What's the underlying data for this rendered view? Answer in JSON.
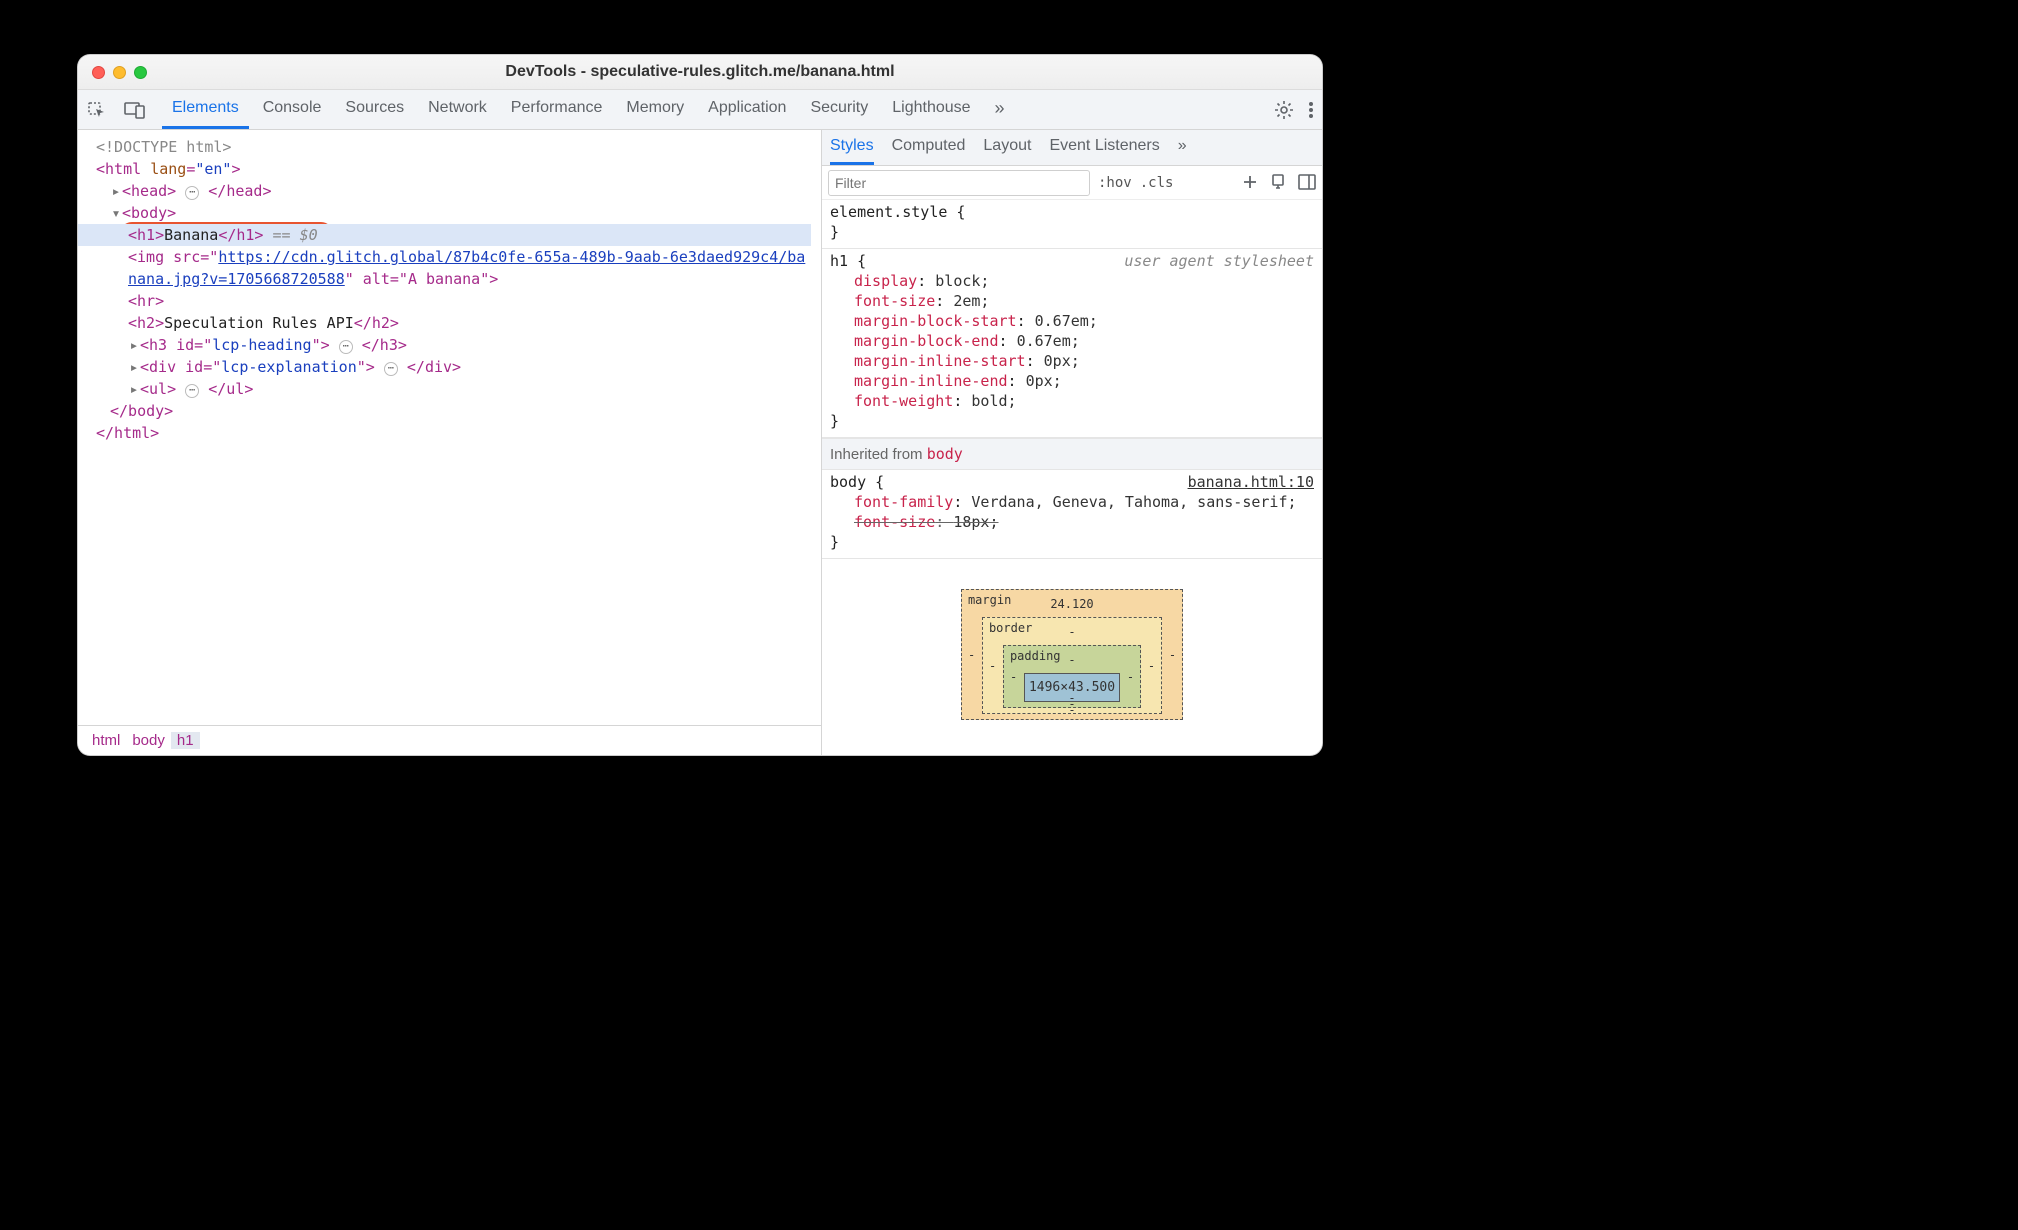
{
  "window": {
    "title": "DevTools - speculative-rules.glitch.me/banana.html"
  },
  "mainTabs": {
    "items": [
      "Elements",
      "Console",
      "Sources",
      "Network",
      "Performance",
      "Memory",
      "Application",
      "Security",
      "Lighthouse"
    ],
    "activeIndex": 0,
    "overflow": "»"
  },
  "dom": {
    "doctype": "<!DOCTYPE html>",
    "htmlOpen": {
      "tag": "html",
      "attrName": "lang",
      "attrVal": "\"en\""
    },
    "headCollapsed": {
      "open": "<head>",
      "close": "</head>"
    },
    "bodyOpen": "<body>",
    "selected": {
      "open": "<h1>",
      "text": "Banana",
      "close": "</h1>",
      "suffix": " == $0"
    },
    "img": {
      "prefix": "<img src=\"",
      "url1": "https://cdn.glitch.global/87b4c0fe-655a-489b-9aab-6e3daed929c4/ba",
      "url2": "nana.jpg?v=1705668720588",
      "altPart": "\" alt=\"A banana\">"
    },
    "hr": "<hr>",
    "h2": {
      "open": "<h2>",
      "text": "Speculation Rules API",
      "close": "</h2>"
    },
    "h3": {
      "open": "<h3 id=\"",
      "id": "lcp-heading",
      "close": "\">",
      "end": "</h3>"
    },
    "div": {
      "open": "<div id=\"",
      "id": "lcp-explanation",
      "close": "\">",
      "end": "</div>"
    },
    "ul": {
      "open": "<ul>",
      "end": "</ul>"
    },
    "bodyClose": "</body>",
    "htmlClose": "</html>"
  },
  "breadcrumb": [
    "html",
    "body",
    "h1"
  ],
  "stylesTabs": {
    "items": [
      "Styles",
      "Computed",
      "Layout",
      "Event Listeners"
    ],
    "activeIndex": 0,
    "overflow": "»"
  },
  "filter": {
    "placeholder": "Filter"
  },
  "stylesToolbar": {
    "hov": ":hov",
    "cls": ".cls"
  },
  "rules": {
    "elementStyle": {
      "selector": "element.style {",
      "close": "}"
    },
    "h1": {
      "selector": "h1 {",
      "ua": "user agent stylesheet",
      "props": [
        {
          "n": "display",
          "v": "block;"
        },
        {
          "n": "font-size",
          "v": "2em;"
        },
        {
          "n": "margin-block-start",
          "v": "0.67em;"
        },
        {
          "n": "margin-block-end",
          "v": "0.67em;"
        },
        {
          "n": "margin-inline-start",
          "v": "0px;"
        },
        {
          "n": "margin-inline-end",
          "v": "0px;"
        },
        {
          "n": "font-weight",
          "v": "bold;"
        }
      ],
      "close": "}"
    },
    "inherited": {
      "label": "Inherited from ",
      "from": "body"
    },
    "body": {
      "selector": "body {",
      "source": "banana.html:10",
      "props": [
        {
          "n": "font-family",
          "v": "Verdana, Geneva, Tahoma, sans-serif;",
          "strike": false
        },
        {
          "n": "font-size",
          "v": "18px;",
          "strike": true
        }
      ],
      "close": "}"
    }
  },
  "boxModel": {
    "marginLabel": "margin",
    "marginTop": "24.120",
    "borderLabel": "border",
    "borderTop": "-",
    "paddingLabel": "padding",
    "paddingTop": "-",
    "content": "1496×43.500",
    "dash": "-"
  }
}
